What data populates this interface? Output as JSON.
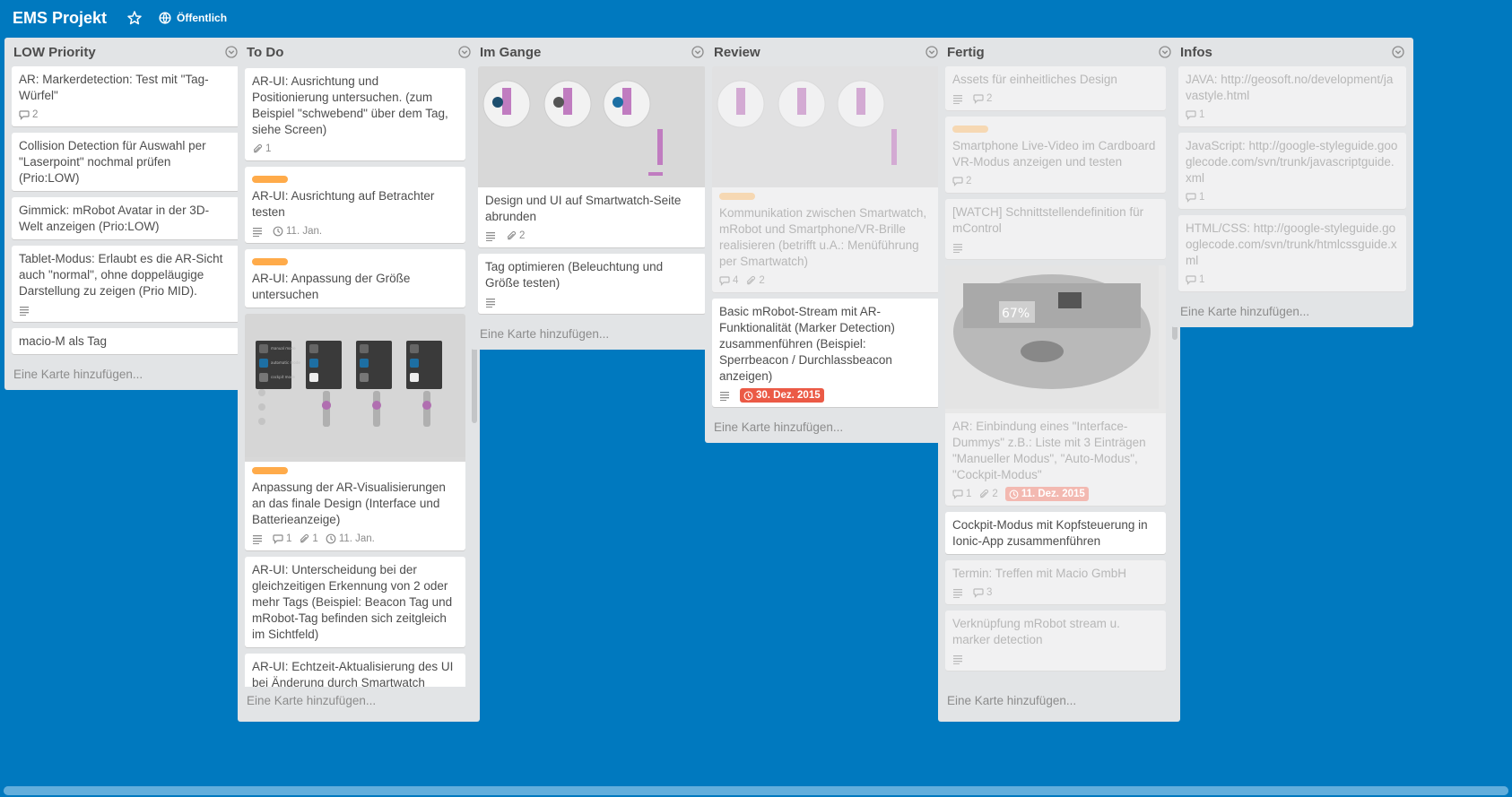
{
  "header": {
    "title": "EMS Projekt",
    "visibility": "Öffentlich"
  },
  "add_card_label": "Eine Karte hinzufügen...",
  "lists": [
    {
      "title": "LOW Priority",
      "cards": [
        {
          "title": "AR: Markerdetection: Test mit \"Tag-Würfel\"",
          "comments": "2"
        },
        {
          "title": "Collision Detection für Auswahl per \"Laserpoint\" nochmal prüfen (Prio:LOW)"
        },
        {
          "title": "Gimmick: mRobot Avatar in der 3D-Welt anzeigen (Prio:LOW)"
        },
        {
          "title": "Tablet-Modus: Erlaubt es die AR-Sicht auch \"normal\", ohne doppeläugige Darstellung zu zeigen (Prio MID)."
        },
        {
          "title": "macio-M als Tag"
        }
      ]
    },
    {
      "title": "To Do",
      "cards": [
        {
          "title": "AR-UI: Ausrichtung und Positionierung untersuchen. (zum Beispiel \"schwebend\" über dem Tag, siehe Screen)",
          "attachments": "1"
        },
        {
          "title": "AR-UI: Ausrichtung auf Betrachter testen",
          "due": "11. Jan."
        },
        {
          "title": "AR-UI: Anpassung der Größe untersuchen"
        },
        {
          "title": "Anpassung der AR-Visualisierungen an das finale Design (Interface und Batterieanzeige)",
          "comments": "1",
          "attachments": "1",
          "due": "11. Jan.",
          "cover_items": [
            "manual mode",
            "automatic mode",
            "cockpit mode"
          ]
        },
        {
          "title": "AR-UI: Unterscheidung bei der gleichzeitigen Erkennung von 2 oder mehr Tags (Beispiel: Beacon Tag und mRobot-Tag befinden sich zeitgleich im Sichtfeld)"
        },
        {
          "title": "AR-UI: Echtzeit-Aktualisierung des UI bei Änderung durch Smartwatch"
        }
      ]
    },
    {
      "title": "Im Gange",
      "cards": [
        {
          "title": "Design und UI auf Smartwatch-Seite abrunden",
          "attachments": "2"
        },
        {
          "title": "Tag optimieren (Beleuchtung und Größe testen)"
        }
      ]
    },
    {
      "title": "Review",
      "cards": [
        {
          "title": "Kommunikation zwischen Smartwatch, mRobot und Smartphone/VR-Brille realisieren (betrifft u.A.: Menüführung per Smartwatch)",
          "comments": "4",
          "attachments": "2"
        },
        {
          "title": "Basic mRobot-Stream mit AR-Funktionalität (Marker Detection) zusammenführen (Beispiel: Sperrbeacon / Durchlassbeacon anzeigen)",
          "due": "30. Dez. 2015"
        }
      ]
    },
    {
      "title": "Fertig",
      "cards": [
        {
          "title": "Assets für einheitliches Design",
          "comments": "2"
        },
        {
          "title": "Smartphone Live-Video im Cardboard VR-Modus anzeigen und testen",
          "comments": "2"
        },
        {
          "title": "[WATCH] Schnittstellendefinition für mControl"
        },
        {
          "title": "AR: Einbindung eines \"Interface-Dummys\" z.B.: Liste mit 3 Einträgen \"Manueller Modus\", \"Auto-Modus\", \"Cockpit-Modus\"",
          "comments": "1",
          "attachments": "2",
          "due": "11. Dez. 2015",
          "cover_text": "67%"
        },
        {
          "title": "Cockpit-Modus mit Kopfsteuerung in Ionic-App zusammenführen"
        },
        {
          "title": "Termin: Treffen mit Macio GmbH",
          "comments": "3"
        },
        {
          "title": "Verknüpfung mRobot stream u. marker detection"
        }
      ]
    },
    {
      "title": "Infos",
      "cards": [
        {
          "title": "JAVA: http://geosoft.no/development/javastyle.html",
          "comments": "1"
        },
        {
          "title": "JavaScript: http://google-styleguide.googlecode.com/svn/trunk/javascriptguide.xml",
          "comments": "1"
        },
        {
          "title": "HTML/CSS: http://google-styleguide.googlecode.com/svn/trunk/htmlcssguide.xml",
          "comments": "1"
        }
      ]
    }
  ],
  "colors": {
    "board_bg": "#0079bf",
    "list_bg": "#e2e4e6",
    "label_orange": "#ffab4a",
    "due_red": "#eb5a46"
  }
}
